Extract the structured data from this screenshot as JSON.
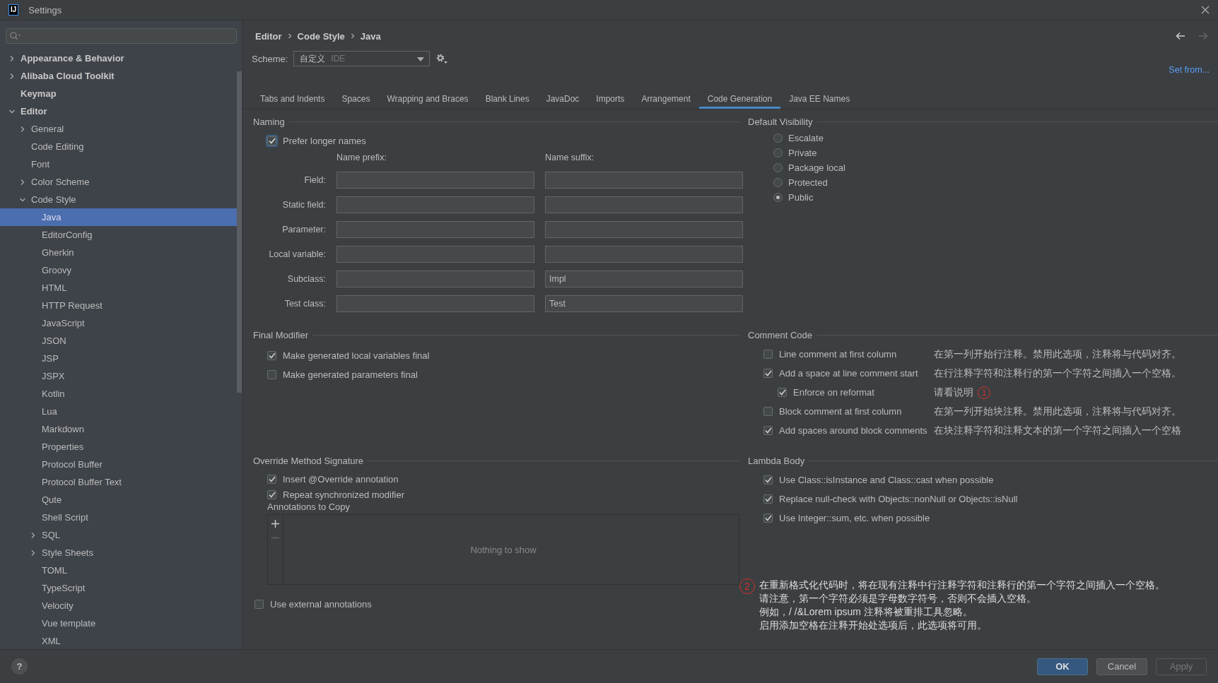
{
  "window": {
    "title": "Settings",
    "logo_text": "IJ"
  },
  "sidebar": {
    "items": [
      {
        "label": "Appearance & Behavior",
        "expanded": false,
        "selected": false
      },
      {
        "label": "Alibaba Cloud Toolkit",
        "expanded": false,
        "selected": false
      },
      {
        "label": "Keymap",
        "selected": false
      },
      {
        "label": "Editor",
        "expanded": true,
        "selected": false,
        "children": [
          {
            "label": "General",
            "expanded": false,
            "selected": false
          },
          {
            "label": "Code Editing",
            "selected": false
          },
          {
            "label": "Font",
            "selected": false
          },
          {
            "label": "Color Scheme",
            "expanded": false,
            "selected": false
          },
          {
            "label": "Code Style",
            "expanded": true,
            "selected": false,
            "children": [
              {
                "label": "Java",
                "selected": true
              },
              {
                "label": "EditorConfig",
                "selected": false
              },
              {
                "label": "Gherkin",
                "selected": false
              },
              {
                "label": "Groovy",
                "selected": false
              },
              {
                "label": "HTML",
                "selected": false
              },
              {
                "label": "HTTP Request",
                "selected": false
              },
              {
                "label": "JavaScript",
                "selected": false
              },
              {
                "label": "JSON",
                "selected": false
              },
              {
                "label": "JSP",
                "selected": false
              },
              {
                "label": "JSPX",
                "selected": false
              },
              {
                "label": "Kotlin",
                "selected": false
              },
              {
                "label": "Lua",
                "selected": false
              },
              {
                "label": "Markdown",
                "selected": false
              },
              {
                "label": "Properties",
                "selected": false
              },
              {
                "label": "Protocol Buffer",
                "selected": false
              },
              {
                "label": "Protocol Buffer Text",
                "selected": false
              },
              {
                "label": "Qute",
                "selected": false
              },
              {
                "label": "Shell Script",
                "selected": false
              },
              {
                "label": "SQL",
                "expanded": false,
                "selected": false
              },
              {
                "label": "Style Sheets",
                "expanded": false,
                "selected": false
              },
              {
                "label": "TOML",
                "selected": false
              },
              {
                "label": "TypeScript",
                "selected": false
              },
              {
                "label": "Velocity",
                "selected": false
              },
              {
                "label": "Vue template",
                "selected": false
              },
              {
                "label": "XML",
                "selected": false
              }
            ]
          }
        ]
      }
    ]
  },
  "breadcrumb": [
    "Editor",
    "Code Style",
    "Java"
  ],
  "scheme": {
    "label": "Scheme:",
    "value": "自定义",
    "secondary": "IDE"
  },
  "set_from": "Set from...",
  "tabs": [
    {
      "label": "Tabs and Indents",
      "selected": false
    },
    {
      "label": "Spaces",
      "selected": false
    },
    {
      "label": "Wrapping and Braces",
      "selected": false
    },
    {
      "label": "Blank Lines",
      "selected": false
    },
    {
      "label": "JavaDoc",
      "selected": false
    },
    {
      "label": "Imports",
      "selected": false
    },
    {
      "label": "Arrangement",
      "selected": false
    },
    {
      "label": "Code Generation",
      "selected": true
    },
    {
      "label": "Java EE Names",
      "selected": false
    }
  ],
  "naming": {
    "title": "Naming",
    "prefer_longer": {
      "label": "Prefer longer names",
      "checked": true
    },
    "prefix_header": "Name prefix:",
    "suffix_header": "Name suffix:",
    "rows": [
      {
        "label": "Field:"
      },
      {
        "label": "Static field:"
      },
      {
        "label": "Parameter:"
      },
      {
        "label": "Local variable:"
      },
      {
        "label": "Subclass:",
        "suffix": "Impl"
      },
      {
        "label": "Test class:",
        "suffix": "Test"
      }
    ]
  },
  "default_visibility": {
    "title": "Default Visibility",
    "options": [
      {
        "label": "Escalate",
        "selected": false
      },
      {
        "label": "Private",
        "selected": false
      },
      {
        "label": "Package local",
        "selected": false
      },
      {
        "label": "Protected",
        "selected": false
      },
      {
        "label": "Public",
        "selected": true
      }
    ]
  },
  "final_modifier": {
    "title": "Final Modifier",
    "options": [
      {
        "label": "Make generated local variables final",
        "checked": true
      },
      {
        "label": "Make generated parameters final",
        "checked": false
      }
    ]
  },
  "comment_code": {
    "title": "Comment Code",
    "options": [
      {
        "label": "Line comment at first column",
        "checked": false,
        "note": "在第一列开始行注释。禁用此选项，注释将与代码对齐。"
      },
      {
        "label": "Add a space at line comment start",
        "checked": true,
        "note": "在行注释字符和注释行的第一个字符之间插入一个空格。",
        "children": [
          {
            "label": "Enforce on reformat",
            "checked": true,
            "note": "请看说明",
            "marker": "1"
          }
        ]
      },
      {
        "label": "Block comment at first column",
        "checked": false,
        "note": "在第一列开始块注释。禁用此选项，注释将与代码对齐。"
      },
      {
        "label": "Add spaces around block comments",
        "checked": true,
        "note": "在块注释字符和注释文本的第一个字符之间插入一个空格"
      }
    ]
  },
  "override_signature": {
    "title": "Override Method Signature",
    "options": [
      {
        "label": "Insert @Override annotation",
        "checked": true
      },
      {
        "label": "Repeat synchronized modifier",
        "checked": true
      }
    ],
    "annotations_label": "Annotations to Copy",
    "empty_text": "Nothing to show",
    "external": {
      "label": "Use external annotations",
      "checked": false
    }
  },
  "lambda_body": {
    "title": "Lambda Body",
    "options": [
      {
        "label": "Use Class::isInstance and Class::cast when possible",
        "checked": true
      },
      {
        "label": "Replace null-check with Objects::nonNull or Objects::isNull",
        "checked": true
      },
      {
        "label": "Use Integer::sum, etc. when possible",
        "checked": true
      }
    ]
  },
  "footnote": {
    "marker": "2",
    "lines": [
      "在重新格式化代码时，将在现有注释中行注释字符和注释行的第一个字符之间插入一个空格。",
      "请注意，第一个字符必须是字母数字符号，否则不会插入空格。",
      "例如，/ /&Lorem ipsum 注释将被重排工具忽略。",
      "启用添加空格在注释开始处选项后，此选项将可用。"
    ]
  },
  "footer": {
    "help": "?",
    "buttons": [
      {
        "label": "OK",
        "kind": "primary"
      },
      {
        "label": "Cancel",
        "kind": "normal"
      },
      {
        "label": "Apply",
        "kind": "disabled"
      }
    ]
  }
}
